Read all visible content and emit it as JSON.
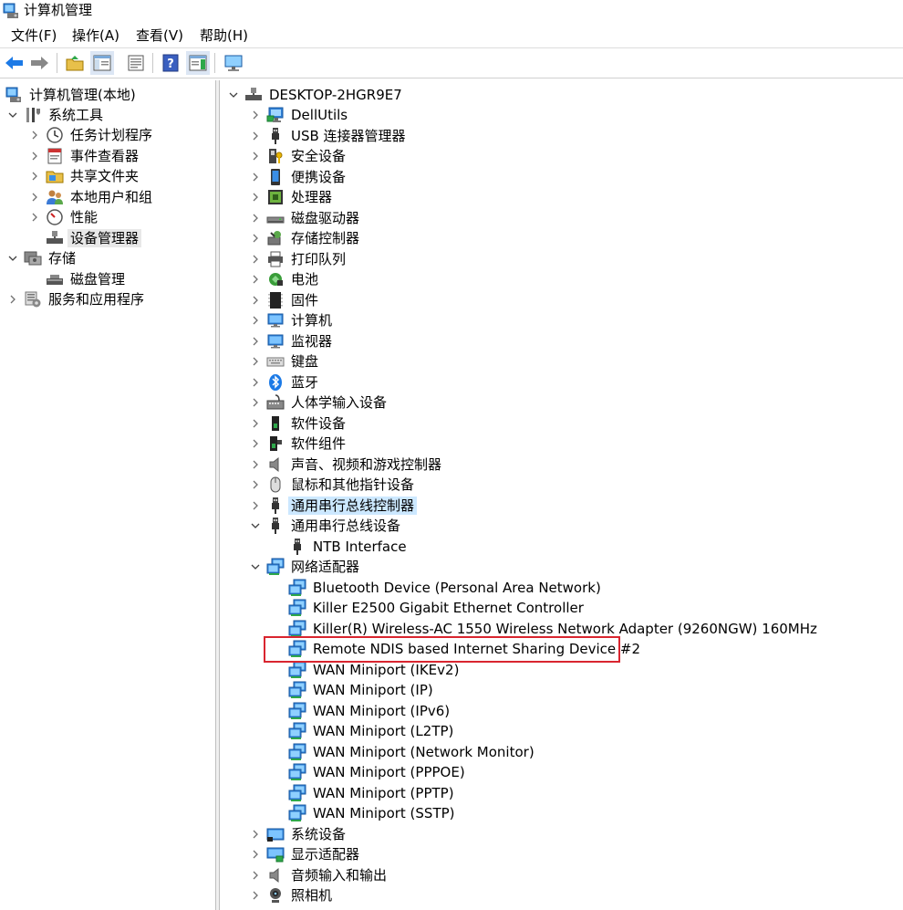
{
  "window": {
    "title": "计算机管理"
  },
  "menu": [
    "文件(F)",
    "操作(A)",
    "查看(V)",
    "帮助(H)"
  ],
  "toolbar": {
    "buttons": [
      "back-icon",
      "forward-icon",
      "up-folder-icon",
      "show-tree-icon",
      "properties-icon",
      "help-icon",
      "show-action-pane-icon",
      "monitor-icon"
    ]
  },
  "left_tree": {
    "root": "计算机管理(本地)",
    "system_tools": "系统工具",
    "task_scheduler": "任务计划程序",
    "event_viewer": "事件查看器",
    "shared_folders": "共享文件夹",
    "local_users": "本地用户和组",
    "performance": "性能",
    "device_manager": "设备管理器",
    "storage": "存储",
    "disk_management": "磁盘管理",
    "services_apps": "服务和应用程序"
  },
  "device_tree": {
    "computer": "DESKTOP-2HGR9E7",
    "categories": {
      "dellutils": "DellUtils",
      "usb_connector": "USB 连接器管理器",
      "security": "安全设备",
      "portable": "便携设备",
      "processor": "处理器",
      "disk": "磁盘驱动器",
      "storage_ctrl": "存储控制器",
      "print_queue": "打印队列",
      "battery": "电池",
      "firmware": "固件",
      "computer_cat": "计算机",
      "monitor": "监视器",
      "keyboard": "键盘",
      "bluetooth": "蓝牙",
      "hid": "人体学输入设备",
      "software_dev": "软件设备",
      "software_comp": "软件组件",
      "audio_video": "声音、视频和游戏控制器",
      "mouse": "鼠标和其他指针设备",
      "usb_ctrl": "通用串行总线控制器",
      "usb_dev": "通用串行总线设备",
      "network": "网络适配器",
      "system_dev": "系统设备",
      "display": "显示适配器",
      "audio_io": "音频输入和输出",
      "camera": "照相机"
    },
    "usb_devices": [
      "NTB Interface"
    ],
    "network_adapters": [
      "Bluetooth Device (Personal Area Network)",
      "Killer E2500 Gigabit Ethernet Controller",
      "Killer(R) Wireless-AC 1550 Wireless Network Adapter (9260NGW) 160MHz",
      "Remote NDIS based Internet Sharing Device #2",
      "WAN Miniport (IKEv2)",
      "WAN Miniport (IP)",
      "WAN Miniport (IPv6)",
      "WAN Miniport (L2TP)",
      "WAN Miniport (Network Monitor)",
      "WAN Miniport (PPPOE)",
      "WAN Miniport (PPTP)",
      "WAN Miniport (SSTP)"
    ]
  },
  "colors": {
    "highlight_box": "#d9252f",
    "hover_row": "#cce8ff",
    "selected_row": "#e8e8e8"
  }
}
